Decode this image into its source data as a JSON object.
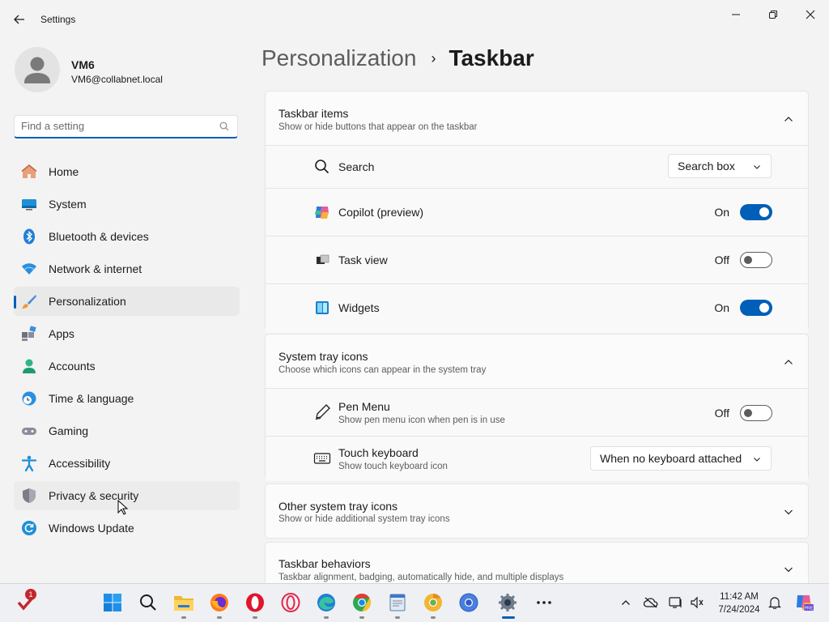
{
  "app": {
    "title": "Settings"
  },
  "profile": {
    "name": "VM6",
    "email": "VM6@collabnet.local"
  },
  "search": {
    "placeholder": "Find a setting"
  },
  "nav": {
    "items": [
      {
        "label": "Home",
        "icon": "home-icon"
      },
      {
        "label": "System",
        "icon": "system-icon"
      },
      {
        "label": "Bluetooth & devices",
        "icon": "bluetooth-icon"
      },
      {
        "label": "Network & internet",
        "icon": "wifi-icon"
      },
      {
        "label": "Personalization",
        "icon": "brush-icon",
        "active": true
      },
      {
        "label": "Apps",
        "icon": "apps-icon"
      },
      {
        "label": "Accounts",
        "icon": "accounts-icon"
      },
      {
        "label": "Time & language",
        "icon": "clock-globe-icon"
      },
      {
        "label": "Gaming",
        "icon": "gamepad-icon"
      },
      {
        "label": "Accessibility",
        "icon": "accessibility-icon"
      },
      {
        "label": "Privacy & security",
        "icon": "shield-icon",
        "hovered": true
      },
      {
        "label": "Windows Update",
        "icon": "update-icon"
      }
    ]
  },
  "breadcrumb": {
    "parent": "Personalization",
    "separator": "›",
    "current": "Taskbar"
  },
  "sections": {
    "taskbar_items": {
      "title": "Taskbar items",
      "description": "Show or hide buttons that appear on the taskbar",
      "expanded": true,
      "rows": {
        "search": {
          "label": "Search",
          "value": "Search box"
        },
        "copilot": {
          "label": "Copilot (preview)",
          "state": "On",
          "on": true
        },
        "taskview": {
          "label": "Task view",
          "state": "Off",
          "on": false
        },
        "widgets": {
          "label": "Widgets",
          "state": "On",
          "on": true
        }
      }
    },
    "system_tray": {
      "title": "System tray icons",
      "description": "Choose which icons can appear in the system tray",
      "expanded": true,
      "rows": {
        "pen": {
          "label": "Pen Menu",
          "sub": "Show pen menu icon when pen is in use",
          "state": "Off",
          "on": false
        },
        "touch": {
          "label": "Touch keyboard",
          "sub": "Show touch keyboard icon",
          "value": "When no keyboard attached"
        }
      }
    },
    "other_tray": {
      "title": "Other system tray icons",
      "description": "Show or hide additional system tray icons",
      "expanded": false
    },
    "behaviors": {
      "title": "Taskbar behaviors",
      "description": "Taskbar alignment, badging, automatically hide, and multiple displays",
      "expanded": false
    }
  },
  "taskbar": {
    "badge_count": "1",
    "clock": {
      "time": "11:42 AM",
      "date": "7/24/2024"
    },
    "pinned": [
      "start-icon",
      "search-icon",
      "file-explorer-icon",
      "firefox-icon",
      "opera-icon",
      "opera-gx-icon",
      "edge-icon",
      "chrome-icon",
      "notepad-icon",
      "chrome-canary-icon",
      "chromium-icon",
      "settings-icon",
      "more-icon"
    ]
  },
  "colors": {
    "accent": "#005fb8",
    "background": "#f3f3f3",
    "card": "#fbfbfb"
  }
}
